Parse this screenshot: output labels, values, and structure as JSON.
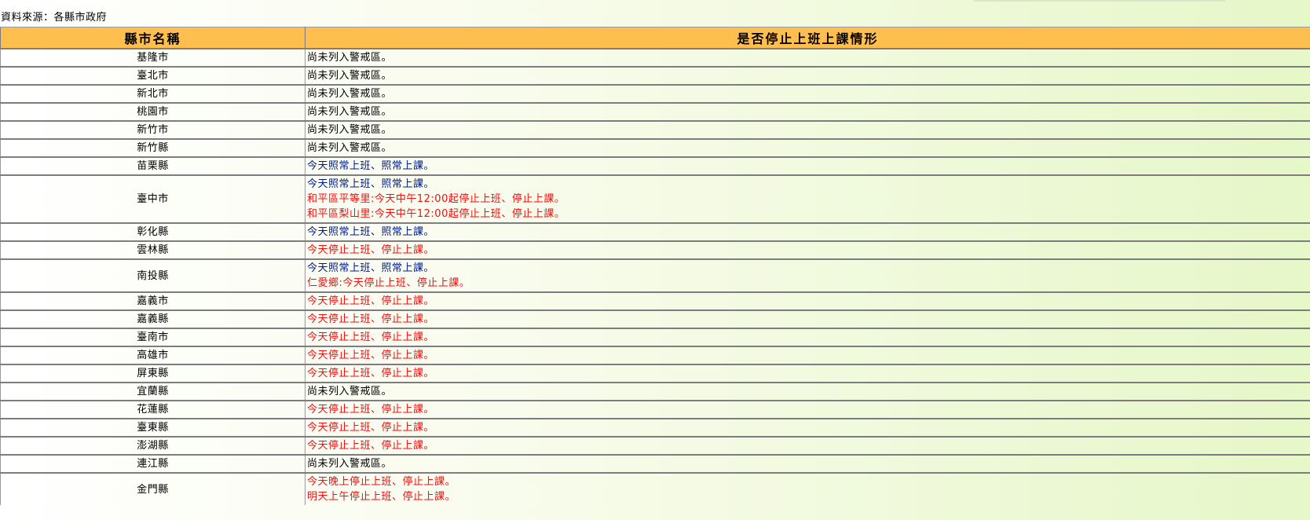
{
  "source_label": "資料來源：各縣市政府",
  "headers": {
    "county": "縣市名稱",
    "status": "是否停止上班上課情形"
  },
  "rows": [
    {
      "name": "基隆市",
      "lines": [
        {
          "text": "尚未列入警戒區。",
          "kind": "normal"
        }
      ]
    },
    {
      "name": "臺北市",
      "lines": [
        {
          "text": "尚未列入警戒區。",
          "kind": "normal"
        }
      ]
    },
    {
      "name": "新北市",
      "lines": [
        {
          "text": "尚未列入警戒區。",
          "kind": "normal"
        }
      ]
    },
    {
      "name": "桃園市",
      "lines": [
        {
          "text": "尚未列入警戒區。",
          "kind": "normal"
        }
      ]
    },
    {
      "name": "新竹市",
      "lines": [
        {
          "text": "尚未列入警戒區。",
          "kind": "normal"
        }
      ]
    },
    {
      "name": "新竹縣",
      "lines": [
        {
          "text": "尚未列入警戒區。",
          "kind": "normal"
        }
      ]
    },
    {
      "name": "苗栗縣",
      "lines": [
        {
          "text": "今天照常上班、照常上課。",
          "kind": "work"
        }
      ]
    },
    {
      "name": "臺中市",
      "lines": [
        {
          "text": "今天照常上班、照常上課。",
          "kind": "work"
        },
        {
          "text": "和平區平等里:今天中午12:00起停止上班、停止上課。",
          "kind": "stop"
        },
        {
          "text": "和平區梨山里:今天中午12:00起停止上班、停止上課。",
          "kind": "stop"
        }
      ]
    },
    {
      "name": "彰化縣",
      "lines": [
        {
          "text": "今天照常上班、照常上課。",
          "kind": "work"
        }
      ]
    },
    {
      "name": "雲林縣",
      "lines": [
        {
          "text": "今天停止上班、停止上課。",
          "kind": "stop"
        }
      ]
    },
    {
      "name": "南投縣",
      "lines": [
        {
          "text": "今天照常上班、照常上課。",
          "kind": "work"
        },
        {
          "text": "仁愛鄉:今天停止上班、停止上課。",
          "kind": "stop"
        }
      ]
    },
    {
      "name": "嘉義市",
      "lines": [
        {
          "text": "今天停止上班、停止上課。",
          "kind": "stop"
        }
      ]
    },
    {
      "name": "嘉義縣",
      "lines": [
        {
          "text": "今天停止上班、停止上課。",
          "kind": "stop"
        }
      ]
    },
    {
      "name": "臺南市",
      "lines": [
        {
          "text": "今天停止上班、停止上課。",
          "kind": "stop"
        }
      ]
    },
    {
      "name": "高雄市",
      "lines": [
        {
          "text": "今天停止上班、停止上課。",
          "kind": "stop"
        }
      ]
    },
    {
      "name": "屏東縣",
      "lines": [
        {
          "text": "今天停止上班、停止上課。",
          "kind": "stop"
        }
      ]
    },
    {
      "name": "宜蘭縣",
      "lines": [
        {
          "text": "尚未列入警戒區。",
          "kind": "normal"
        }
      ]
    },
    {
      "name": "花蓮縣",
      "lines": [
        {
          "text": "今天停止上班、停止上課。",
          "kind": "stop"
        }
      ]
    },
    {
      "name": "臺東縣",
      "lines": [
        {
          "text": "今天停止上班、停止上課。",
          "kind": "stop"
        }
      ]
    },
    {
      "name": "澎湖縣",
      "lines": [
        {
          "text": "今天停止上班、停止上課。",
          "kind": "stop"
        }
      ]
    },
    {
      "name": "連江縣",
      "lines": [
        {
          "text": "尚未列入警戒區。",
          "kind": "normal"
        }
      ]
    },
    {
      "name": "金門縣",
      "lines": [
        {
          "text": "今天晚上停止上班、停止上課。",
          "kind": "stop"
        },
        {
          "text": "明天上午停止上班、停止上課。",
          "kind": "stop"
        }
      ]
    }
  ],
  "colors": {
    "header_bg": "#ffbf4f",
    "normal": "#000000",
    "work": "#001b86",
    "stop": "#ee1111"
  }
}
